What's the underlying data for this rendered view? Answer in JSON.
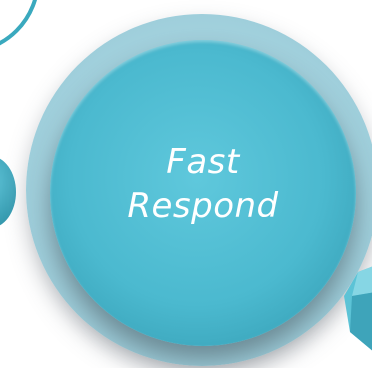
{
  "label": {
    "line1": "Fast",
    "line2": "Respond"
  }
}
